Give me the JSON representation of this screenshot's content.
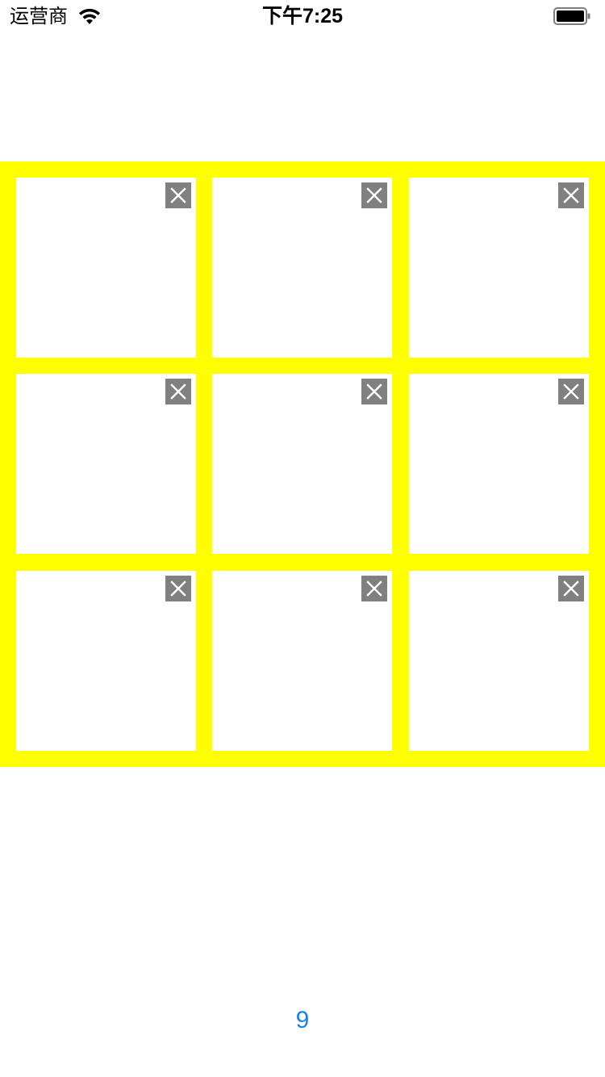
{
  "status_bar": {
    "carrier": "运营商",
    "time": "下午7:25",
    "icons": [
      "wifi-icon",
      "battery-icon"
    ]
  },
  "grid": {
    "background_color": "#ffff00",
    "cells": [
      {
        "close_icon": "close-icon"
      },
      {
        "close_icon": "close-icon"
      },
      {
        "close_icon": "close-icon"
      },
      {
        "close_icon": "close-icon"
      },
      {
        "close_icon": "close-icon"
      },
      {
        "close_icon": "close-icon"
      },
      {
        "close_icon": "close-icon"
      },
      {
        "close_icon": "close-icon"
      },
      {
        "close_icon": "close-icon"
      }
    ]
  },
  "counter": {
    "value": "9",
    "color": "#1a7ff0"
  }
}
